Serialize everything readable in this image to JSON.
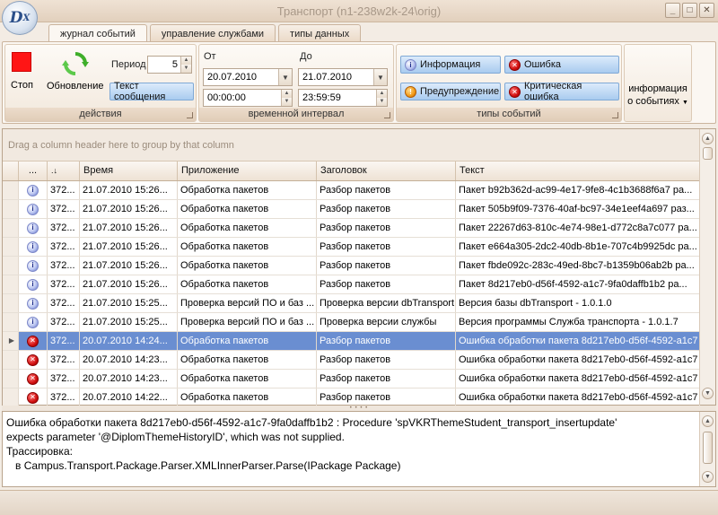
{
  "window": {
    "title": "Транспорт (n1-238w2k-24\\orig)",
    "logo_text": "D",
    "logo_sub": "X"
  },
  "ribbon_tabs": [
    {
      "label": "журнал событий",
      "active": true
    },
    {
      "label": "управление службами",
      "active": false
    },
    {
      "label": "типы данных",
      "active": false
    }
  ],
  "actions": {
    "group_label": "действия",
    "stop_label": "Стоп",
    "refresh_label": "Обновление",
    "period_label": "Период",
    "period_value": "5",
    "message_text_button": "Текст сообщения"
  },
  "time_interval": {
    "group_label": "временной интервал",
    "from_label": "От",
    "to_label": "До",
    "from_date": "20.07.2010",
    "from_time": "00:00:00",
    "to_date": "21.07.2010",
    "to_time": "23:59:59"
  },
  "event_types": {
    "group_label": "типы событий",
    "info": "Информация",
    "error": "Ошибка",
    "warning": "Предупреждение",
    "critical": "Критическая ошибка"
  },
  "event_info": {
    "line1": "информация",
    "line2": "о событиях"
  },
  "grid": {
    "group_panel_hint": "Drag a column header here to group by that column",
    "columns": [
      "...",
      "",
      "Время",
      "Приложение",
      "Заголовок",
      "Текст"
    ],
    "rows": [
      {
        "type": "info",
        "id": "372...",
        "time": "21.07.2010 15:26...",
        "app": "Обработка пакетов",
        "header": "Разбор пакетов",
        "text": "Пакет b92b362d-ac99-4e17-9fe8-4c1b3688f6a7 ра..."
      },
      {
        "type": "info",
        "id": "372...",
        "time": "21.07.2010 15:26...",
        "app": "Обработка пакетов",
        "header": "Разбор пакетов",
        "text": "Пакет 505b9f09-7376-40af-bc97-34e1eef4a697 раз..."
      },
      {
        "type": "info",
        "id": "372...",
        "time": "21.07.2010 15:26...",
        "app": "Обработка пакетов",
        "header": "Разбор пакетов",
        "text": "Пакет 22267d63-810c-4e74-98e1-d772c8a7c077 ра..."
      },
      {
        "type": "info",
        "id": "372...",
        "time": "21.07.2010 15:26...",
        "app": "Обработка пакетов",
        "header": "Разбор пакетов",
        "text": "Пакет e664a305-2dc2-40db-8b1e-707c4b9925dc ра..."
      },
      {
        "type": "info",
        "id": "372...",
        "time": "21.07.2010 15:26...",
        "app": "Обработка пакетов",
        "header": "Разбор пакетов",
        "text": "Пакет fbde092c-283c-49ed-8bc7-b1359b06ab2b ра..."
      },
      {
        "type": "info",
        "id": "372...",
        "time": "21.07.2010 15:26...",
        "app": "Обработка пакетов",
        "header": "Разбор пакетов",
        "text": "Пакет 8d217eb0-d56f-4592-a1c7-9fa0daffb1b2 ра..."
      },
      {
        "type": "info",
        "id": "372...",
        "time": "21.07.2010 15:25...",
        "app": "Проверка версий ПО и баз ...",
        "header": "Проверка версии dbTransport",
        "text": "Версия базы dbTransport - 1.0.1.0"
      },
      {
        "type": "info",
        "id": "372...",
        "time": "21.07.2010 15:25...",
        "app": "Проверка версий ПО и баз ...",
        "header": "Проверка версии службы",
        "text": "Версия программы Служба транспорта - 1.0.1.7"
      },
      {
        "type": "error",
        "id": "372...",
        "time": "20.07.2010 14:24...",
        "app": "Обработка пакетов",
        "header": "Разбор пакетов",
        "text": "Ошибка обработки пакета 8d217eb0-d56f-4592-a1c7",
        "selected": true
      },
      {
        "type": "error",
        "id": "372...",
        "time": "20.07.2010 14:23...",
        "app": "Обработка пакетов",
        "header": "Разбор пакетов",
        "text": "Ошибка обработки пакета 8d217eb0-d56f-4592-a1c7"
      },
      {
        "type": "error",
        "id": "372...",
        "time": "20.07.2010 14:23...",
        "app": "Обработка пакетов",
        "header": "Разбор пакетов",
        "text": "Ошибка обработки пакета 8d217eb0-d56f-4592-a1c7"
      },
      {
        "type": "error",
        "id": "372...",
        "time": "20.07.2010 14:22...",
        "app": "Обработка пакетов",
        "header": "Разбор пакетов",
        "text": "Ошибка обработки пакета 8d217eb0-d56f-4592-a1c7"
      }
    ]
  },
  "detail": {
    "text": "Ошибка обработки пакета 8d217eb0-d56f-4592-a1c7-9fa0daffb1b2 : Procedure 'spVKRThemeStudent_transport_insertupdate'\nexpects parameter '@DiplomThemeHistoryID', which was not supplied.\nТрассировка:\n   в Campus.Transport.Package.Parser.XMLInnerParser.Parse(IPackage Package)"
  },
  "colors": {
    "selection": "#6a8ed1",
    "stop": "#ff1515",
    "accent_button": "#a9cbef"
  }
}
